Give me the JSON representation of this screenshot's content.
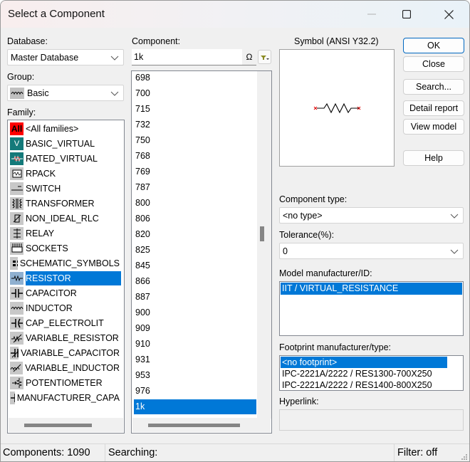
{
  "window": {
    "title": "Select a Component",
    "controls": {
      "minimize": "minimize",
      "maximize": "maximize",
      "close": "close"
    }
  },
  "database": {
    "label": "Database:",
    "value": "Master Database"
  },
  "group": {
    "label": "Group:",
    "value": "Basic",
    "icon": "basic-group-icon"
  },
  "family": {
    "label": "Family:",
    "selected": "RESISTOR",
    "items": [
      {
        "label": "<All families>",
        "icon": "all-families-icon",
        "icon_text": "All"
      },
      {
        "label": "BASIC_VIRTUAL",
        "icon": "basic-virtual-icon"
      },
      {
        "label": "RATED_VIRTUAL",
        "icon": "rated-virtual-icon"
      },
      {
        "label": "RPACK",
        "icon": "rpack-icon"
      },
      {
        "label": "SWITCH",
        "icon": "switch-icon"
      },
      {
        "label": "TRANSFORMER",
        "icon": "transformer-icon"
      },
      {
        "label": "NON_IDEAL_RLC",
        "icon": "non-ideal-rlc-icon"
      },
      {
        "label": "RELAY",
        "icon": "relay-icon"
      },
      {
        "label": "SOCKETS",
        "icon": "sockets-icon"
      },
      {
        "label": "SCHEMATIC_SYMBOLS",
        "icon": "schematic-symbols-icon"
      },
      {
        "label": "RESISTOR",
        "icon": "resistor-icon"
      },
      {
        "label": "CAPACITOR",
        "icon": "capacitor-icon"
      },
      {
        "label": "INDUCTOR",
        "icon": "inductor-icon"
      },
      {
        "label": "CAP_ELECTROLIT",
        "icon": "cap-electrolit-icon"
      },
      {
        "label": "VARIABLE_RESISTOR",
        "icon": "variable-resistor-icon"
      },
      {
        "label": "VARIABLE_CAPACITOR",
        "icon": "variable-capacitor-icon"
      },
      {
        "label": "VARIABLE_INDUCTOR",
        "icon": "variable-inductor-icon"
      },
      {
        "label": "POTENTIOMETER",
        "icon": "potentiometer-icon"
      },
      {
        "label": "MANUFACTURER_CAPA",
        "icon": "manufacturer-capacitor-icon"
      }
    ]
  },
  "component": {
    "label": "Component:",
    "search_value": "1k",
    "unit_symbol": "Ω",
    "selected": "1k",
    "items": [
      "698",
      "700",
      "715",
      "732",
      "750",
      "768",
      "769",
      "787",
      "800",
      "806",
      "820",
      "825",
      "845",
      "866",
      "887",
      "900",
      "909",
      "910",
      "931",
      "953",
      "976",
      "1k"
    ]
  },
  "symbol": {
    "label": "Symbol (ANSI Y32.2)"
  },
  "buttons": {
    "ok": "OK",
    "close": "Close",
    "search": "Search...",
    "detail_report": "Detail report",
    "view_model": "View model",
    "help": "Help"
  },
  "component_type": {
    "label": "Component type:",
    "value": "<no type>"
  },
  "tolerance": {
    "label": "Tolerance(%):",
    "value": "0"
  },
  "model": {
    "label": "Model manufacturer/ID:",
    "items": [
      "IIT / VIRTUAL_RESISTANCE"
    ],
    "selected": "IIT / VIRTUAL_RESISTANCE"
  },
  "footprint": {
    "label": "Footprint manufacturer/type:",
    "items": [
      "<no footprint>",
      "IPC-2221A/2222 / RES1300-700X250",
      "IPC-2221A/2222 / RES1400-800X250"
    ],
    "selected": "<no footprint>"
  },
  "hyperlink": {
    "label": "Hyperlink:",
    "value": ""
  },
  "status": {
    "components": "Components: 1090",
    "searching": "Searching:",
    "filter": "Filter: off"
  },
  "colors": {
    "selection": "#0078d7",
    "pin_marker": "#e00000"
  }
}
